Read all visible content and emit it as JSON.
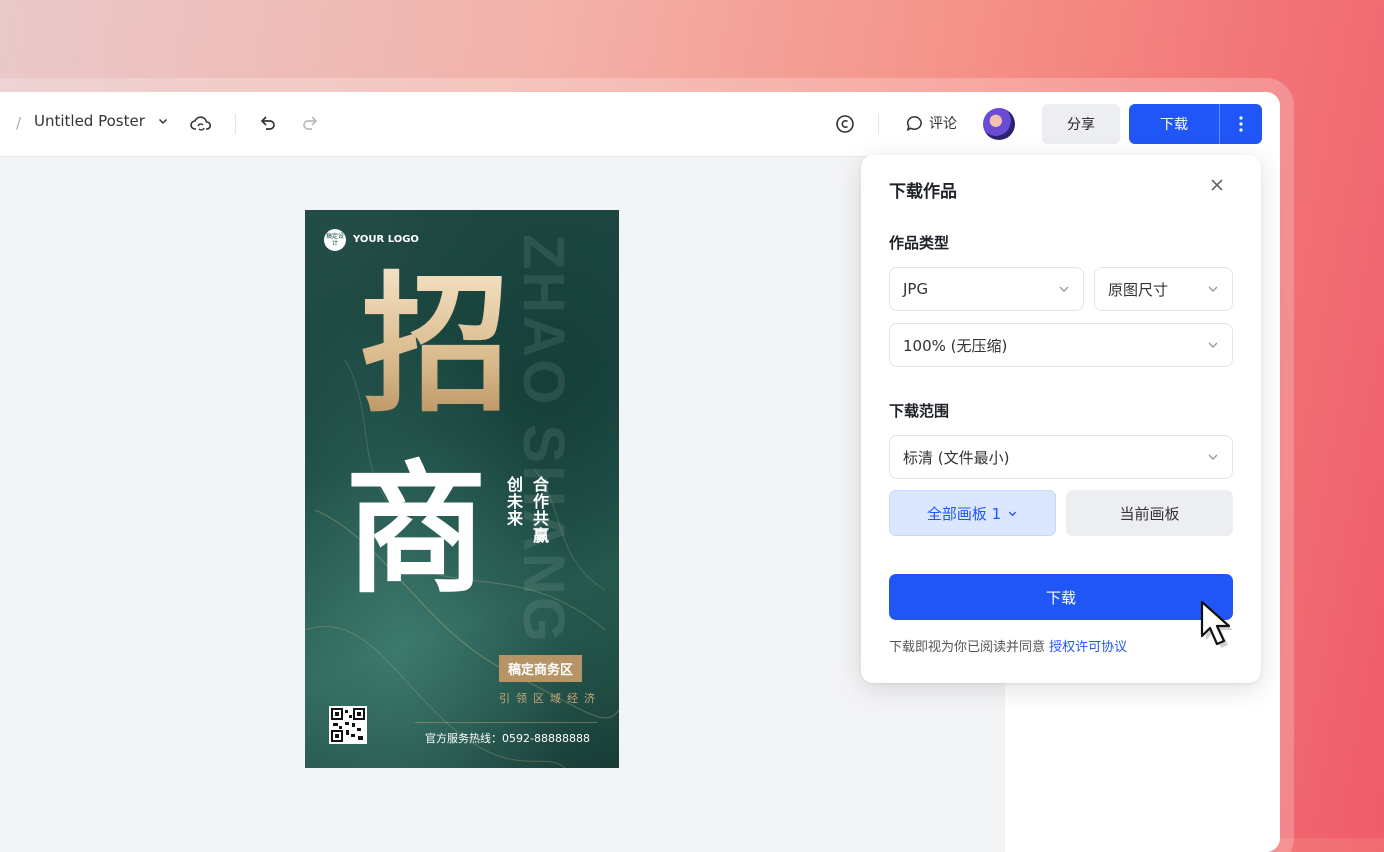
{
  "toolbar": {
    "breadcrumb_sep": "/",
    "doc_title": "Untitled Poster",
    "comment_label": "评论",
    "share_label": "分享",
    "download_label": "下载",
    "icons": [
      "cloud-sync-icon",
      "undo-icon",
      "redo-icon",
      "copyright-icon",
      "comment-icon",
      "chevron-down-icon",
      "more-vertical-icon"
    ]
  },
  "poster": {
    "logo_badge": "稿定设计",
    "logo_text": "YOUR LOGO",
    "watermark": "ZHAO SHANG",
    "char1": "招",
    "char2": "商",
    "col_right": "合作共赢",
    "col_left": "创未来",
    "tag": "稿定商务区",
    "subtitle": "引领区域经济",
    "hotline": "官方服务热线：0592-88888888"
  },
  "download_panel": {
    "title": "下载作品",
    "type_label": "作品类型",
    "format_value": "JPG",
    "size_value": "原图尺寸",
    "quality_value": "100% (无压缩)",
    "range_label": "下载范围",
    "resolution_value": "标清 (文件最小)",
    "all_boards": "全部画板 1",
    "current_board": "当前画板",
    "download_button": "下载",
    "agree_text": "下载即视为你已阅读并同意 ",
    "license_link": "授权许可协议"
  },
  "colors": {
    "primary": "#2156f6",
    "poster_green": "#1c4a42",
    "gold": "#b79466"
  }
}
